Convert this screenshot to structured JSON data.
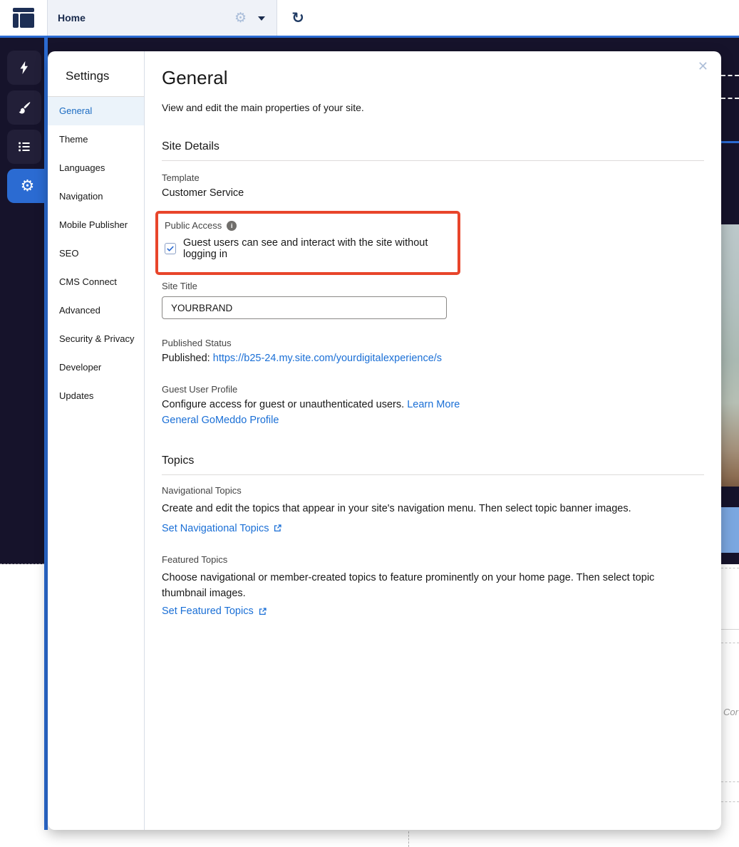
{
  "colors": {
    "accent_blue": "#2b6bd2",
    "link_blue": "#1a6fd6",
    "highlight_red": "#e8452b",
    "canvas_navy": "#16132b",
    "active_nav_blue": "#1b6bc2",
    "behind_blue_block": "#7ba7e0"
  },
  "icons": {
    "gear": "⚙",
    "refresh": "↻",
    "close": "✕",
    "info": "i"
  },
  "topbar": {
    "page_label": "Home"
  },
  "panel": {
    "sidebar": {
      "title": "Settings",
      "items": [
        {
          "label": "General",
          "active": true
        },
        {
          "label": "Theme",
          "active": false
        },
        {
          "label": "Languages",
          "active": false
        },
        {
          "label": "Navigation",
          "active": false
        },
        {
          "label": "Mobile Publisher",
          "active": false
        },
        {
          "label": "SEO",
          "active": false
        },
        {
          "label": "CMS Connect",
          "active": false
        },
        {
          "label": "Advanced",
          "active": false
        },
        {
          "label": "Security & Privacy",
          "active": false
        },
        {
          "label": "Developer",
          "active": false
        },
        {
          "label": "Updates",
          "active": false
        }
      ]
    },
    "content": {
      "title": "General",
      "subtitle": "View and edit the main properties of your site.",
      "site_details": {
        "heading": "Site Details",
        "template_label": "Template",
        "template_value": "Customer Service",
        "public_access_label": "Public Access",
        "public_access_checkbox_label": "Guest users can see and interact with the site without logging in",
        "public_access_checked": true,
        "site_title_label": "Site Title",
        "site_title_value": "YOURBRAND",
        "published_status_label": "Published Status",
        "published_prefix": "Published:",
        "published_url": "https://b25-24.my.site.com/yourdigitalexperience/s",
        "guest_profile_label": "Guest User Profile",
        "guest_profile_text": "Configure access for guest or unauthenticated users.",
        "guest_profile_learn_more": "Learn More",
        "guest_profile_link": "General GoMeddo Profile"
      },
      "topics": {
        "heading": "Topics",
        "navigational_label": "Navigational Topics",
        "navigational_description": "Create and edit the topics that appear in your site's navigation menu. Then select topic banner images.",
        "navigational_link": "Set Navigational Topics",
        "featured_label": "Featured Topics",
        "featured_description": "Choose navigational or member-created topics to feature prominently on your home page. Then select topic thumbnail images.",
        "featured_link": "Set Featured Topics"
      }
    }
  },
  "background": {
    "overflow_text": "Cor"
  }
}
